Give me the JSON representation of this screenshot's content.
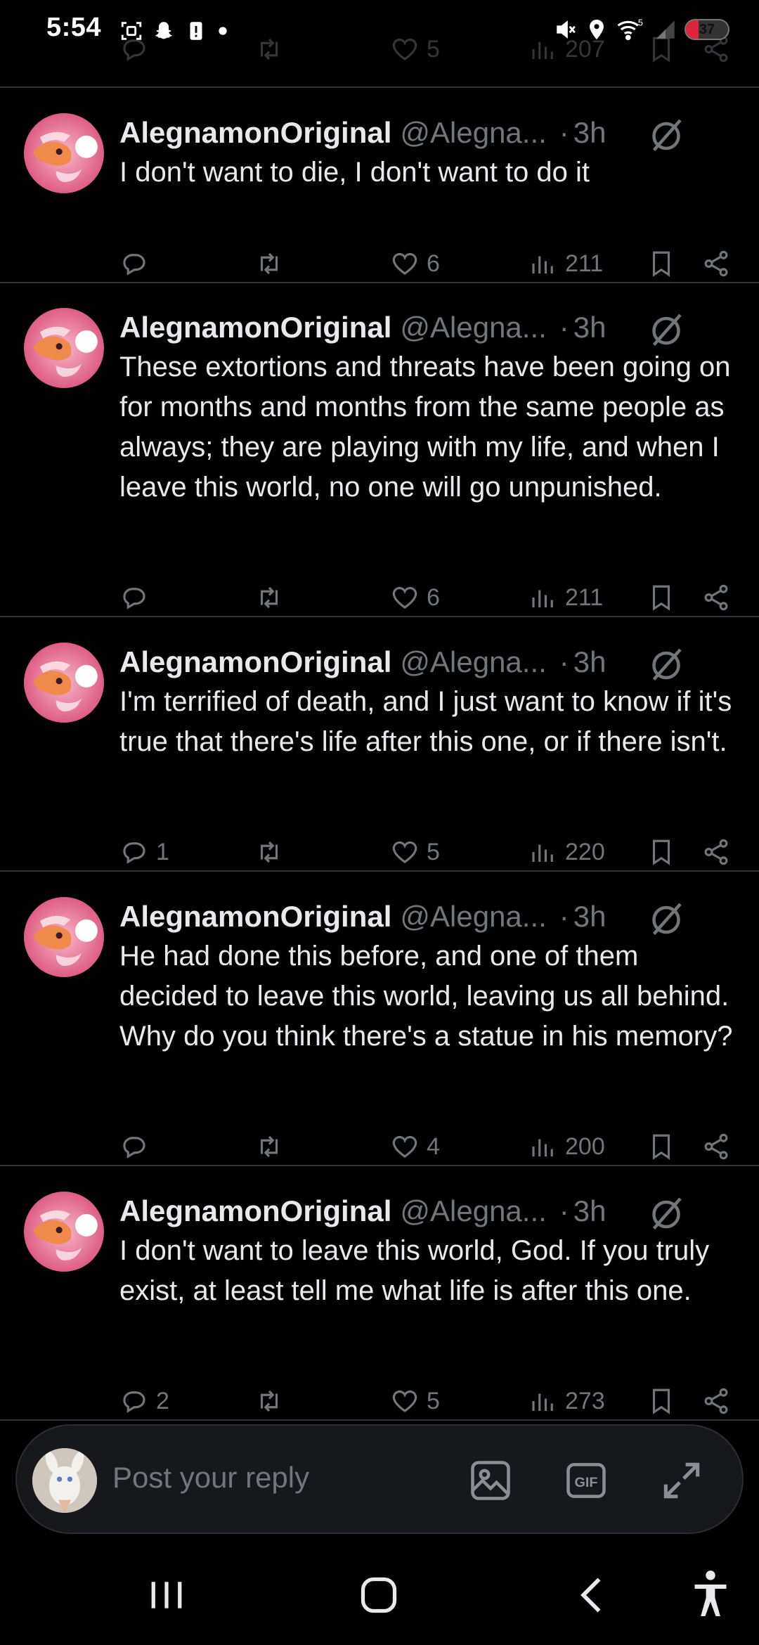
{
  "status_bar": {
    "time": "5:54",
    "battery_level": "37",
    "wifi_badge": "5",
    "icons": [
      "screenshot-icon",
      "snapchat-icon",
      "alert-icon",
      "dot-icon",
      "mute-icon",
      "location-icon",
      "wifi-icon",
      "signal-icon",
      "battery-icon"
    ]
  },
  "partial_tweet": {
    "likes": "5",
    "views": "207"
  },
  "tweets": [
    {
      "name": "AlegnamonOriginal",
      "handle": "@Alegna...",
      "dot": "·",
      "time": "3h",
      "text": "I don't want to die, I don't want to do it",
      "replies": "",
      "likes": "6",
      "views": "211"
    },
    {
      "name": "AlegnamonOriginal",
      "handle": "@Alegna...",
      "dot": "·",
      "time": "3h",
      "text": "These extortions and threats have been going on for months and months from the same people as always; they are playing with my life, and when I leave this world, no one will go unpunished.",
      "replies": "",
      "likes": "6",
      "views": "211"
    },
    {
      "name": "AlegnamonOriginal",
      "handle": "@Alegna...",
      "dot": "·",
      "time": "3h",
      "text": "I'm terrified of death, and I just want to know if it's true that there's life after this one, or if there isn't.",
      "replies": "1",
      "likes": "5",
      "views": "220"
    },
    {
      "name": "AlegnamonOriginal",
      "handle": "@Alegna...",
      "dot": "·",
      "time": "3h",
      "text": "He had done this before, and one of them decided to leave this world, leaving us all behind. Why do you think there's a statue in his memory?",
      "replies": "",
      "likes": "4",
      "views": "200"
    },
    {
      "name": "AlegnamonOriginal",
      "handle": "@Alegna...",
      "dot": "·",
      "time": "3h",
      "text": "I don't want to leave this world, God. If you truly exist, at least tell me what life is after this one.",
      "replies": "2",
      "likes": "5",
      "views": "273"
    }
  ],
  "composer": {
    "placeholder": "Post your reply",
    "gif_label": "GIF"
  },
  "colors": {
    "background": "#000000",
    "text": "#e7e9ea",
    "secondary_text": "#71767b",
    "divider": "#2f3336",
    "composer_bg": "#16181c"
  }
}
